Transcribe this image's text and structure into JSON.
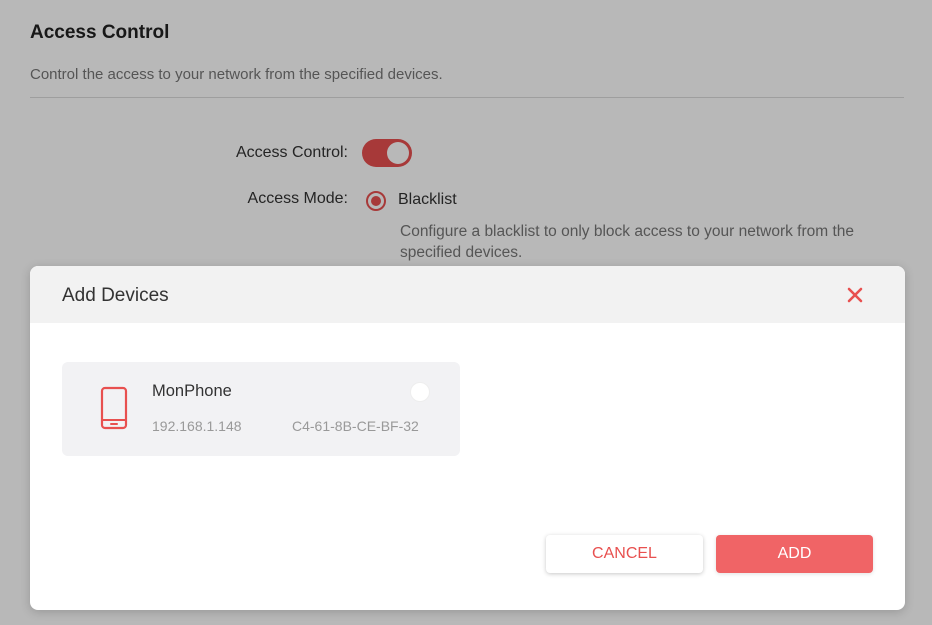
{
  "section": {
    "title": "Access Control",
    "description": "Control the access to your network from the specified devices."
  },
  "form": {
    "access_control_label": "Access Control:",
    "access_control_enabled": true,
    "access_mode_label": "Access Mode:",
    "access_mode_value": "Blacklist",
    "access_mode_description": "Configure a blacklist to only block access to your network from the specified devices."
  },
  "modal": {
    "title": "Add Devices",
    "close_icon": "close-icon",
    "devices": [
      {
        "name": "MonPhone",
        "ip": "192.168.1.148",
        "mac": "C4-61-8B-CE-BF-32",
        "icon": "phone-icon",
        "selected": false
      }
    ],
    "cancel_label": "CANCEL",
    "add_label": "ADD"
  },
  "colors": {
    "accent": "#e8504f",
    "add_button": "#f06466"
  }
}
